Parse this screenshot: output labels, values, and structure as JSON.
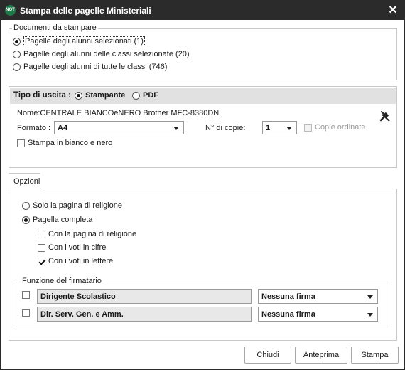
{
  "window": {
    "app_icon": "NOT",
    "title": "Stampa delle pagelle Ministeriali",
    "close_glyph": "✕"
  },
  "documents": {
    "legend": "Documenti da stampare",
    "options": [
      {
        "label": "Pagelle degli alunni selezionati (1)",
        "selected": true
      },
      {
        "label": "Pagelle degli alunni delle classi selezionate (20)",
        "selected": false
      },
      {
        "label": "Pagelle degli alunni di tutte le classi (746)",
        "selected": false
      }
    ]
  },
  "output": {
    "label": "Tipo di uscita :",
    "printer_label": "Stampante",
    "pdf_label": "PDF",
    "selected": "printer",
    "printer_name": "Nome:CENTRALE BIANCOeNERO Brother MFC-8380DN",
    "format_label": "Formato :",
    "format_value": "A4",
    "copies_label": "N° di copie:",
    "copies_value": "1",
    "collate_label": "Copie ordinate",
    "bw_label": "Stampa in bianco e nero",
    "settings_icon": "tools-icon"
  },
  "options_tab": {
    "label": "Opzioni",
    "radios": [
      {
        "label": "Solo la pagina di religione",
        "selected": false
      },
      {
        "label": "Pagella completa",
        "selected": true
      }
    ],
    "checks": [
      {
        "label": "Con la pagina di religione",
        "checked": false
      },
      {
        "label": "Con i voti in cifre",
        "checked": false
      },
      {
        "label": "Con i voti in lettere",
        "checked": true
      }
    ]
  },
  "signature": {
    "legend": "Funzione del firmatario",
    "rows": [
      {
        "role": "Dirigente Scolastico",
        "signature": "Nessuna firma",
        "checked": false
      },
      {
        "role": "Dir. Serv. Gen. e Amm.",
        "signature": "Nessuna firma",
        "checked": false
      }
    ]
  },
  "buttons": {
    "close": "Chiudi",
    "preview": "Anteprima",
    "print": "Stampa"
  }
}
